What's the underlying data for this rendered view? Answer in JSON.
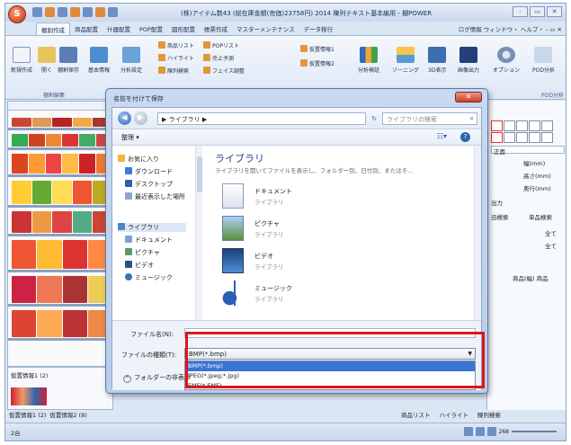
{
  "app": {
    "orb_label": "S",
    "title": "(株)アイテム数43  (総在庫金額(売価)23758円)  2014 陳列テキスト基本編用 - 棚POWER",
    "tabs": [
      "棚割作成",
      "商品配置",
      "什器配置",
      "POP配置",
      "図形配置",
      "帳票作成",
      "マスターメンテナンス",
      "データ移行"
    ],
    "right_menu": "ログ情報  ウィンドウ・  ヘルプ・  ‐ ▭ ✕",
    "window_controls": [
      "‐",
      "▭",
      "✕"
    ]
  },
  "ribbon": {
    "buttons": [
      {
        "label": "新規作成"
      },
      {
        "label": "開く"
      },
      {
        "label": "棚割保存"
      },
      {
        "label": "基本情報"
      },
      {
        "label": "分析設定"
      },
      {
        "label": "分析検証"
      },
      {
        "label": "ゾーニング"
      },
      {
        "label": "3D表示"
      },
      {
        "label": "画像出力"
      },
      {
        "label": "オプション"
      },
      {
        "label": "POD分析"
      }
    ],
    "small_items": [
      "商品リスト",
      "POPリスト",
      "ハイライト",
      "売上予測",
      "陳列検索",
      "フェイス調整",
      "仮置情報1",
      "仮置情報2"
    ],
    "group_labels": [
      "棚割編集",
      "POD分析"
    ]
  },
  "left_panel": {
    "lower_label": "仮置情報1 (2)",
    "bottom_tabs": [
      "仮置情報1 (2)",
      "仮置情報2 (8)"
    ]
  },
  "right_panel": {
    "combo": "正面",
    "fields": [
      "幅(mm)",
      "高さ(mm)",
      "奥行(mm)"
    ],
    "output": "出力",
    "search_tabs": [
      "迅検索",
      "単品検索"
    ],
    "all1": "全て",
    "all2": "全て",
    "col_header": "商品(幅)  商品",
    "tabs": [
      "商品リスト",
      "ハイライト",
      "陳列検索"
    ]
  },
  "status": {
    "left": "2台",
    "zoom": "268"
  },
  "dialog": {
    "title": "名前を付けて保存",
    "close": "✕",
    "address": "▶ ライブラリ ▶",
    "search_placeholder": "ライブラリの検索",
    "organize": "整理 ▾",
    "nav": [
      {
        "label": "お気に入り",
        "color": "#f3b53a"
      },
      {
        "label": "ダウンロード",
        "color": "#3a7bd5"
      },
      {
        "label": "デスクトップ",
        "color": "#2f5fa8"
      },
      {
        "label": "最近表示した場所",
        "color": "#8fa6c9"
      },
      {
        "label": "ライブラリ",
        "color": "#4d86c7"
      },
      {
        "label": "ドキュメント",
        "color": "#7da0d0"
      },
      {
        "label": "ピクチャ",
        "color": "#5a9a62"
      },
      {
        "label": "ビデオ",
        "color": "#2b4f86"
      },
      {
        "label": "ミュージック",
        "color": "#3b6fc0"
      }
    ],
    "lib_title": "ライブラリ",
    "lib_desc": "ライブラリを開いてファイルを表示し、フォルダー別、日付別、またはそ...",
    "libraries": [
      {
        "name": "ドキュメント",
        "sub": "ライブラリ"
      },
      {
        "name": "ピクチャ",
        "sub": "ライブラリ"
      },
      {
        "name": "ビデオ",
        "sub": "ライブラリ"
      },
      {
        "name": "ミュージック",
        "sub": "ライブラリ"
      }
    ],
    "filename_label": "ファイル名(N):",
    "filename_value": "",
    "filetype_label": "ファイルの種類(T):",
    "filetype_value": "BMP(*.bmp)",
    "filetype_options": [
      "BMP(*.bmp)",
      "JPEG(*.jpeg;*.jpg)",
      "EMF(*.EMF)"
    ],
    "folder_toggle": "フォルダーの非表示"
  },
  "colors": {
    "highlight": "#e0141e",
    "selection": "#3b74d4"
  }
}
